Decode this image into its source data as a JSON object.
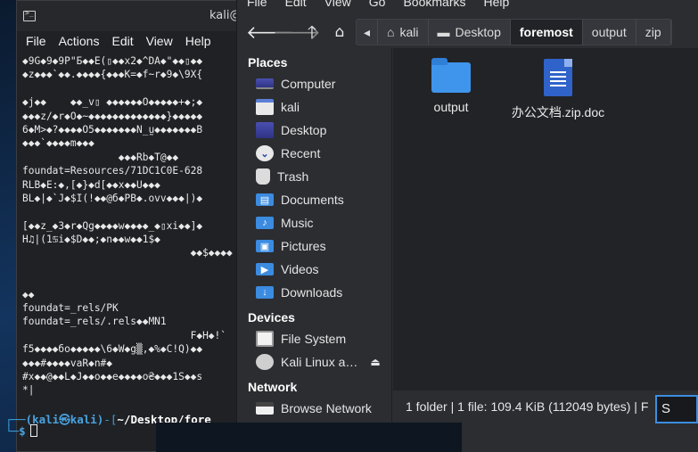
{
  "terminal": {
    "title": "kali@",
    "menu": [
      "File",
      "Actions",
      "Edit",
      "View",
      "Help"
    ],
    "lines": [
      "◆9G◆9◆9P\"Б◆◆E(▯◆◆x2◆^DA◆\"◆◆▯◆◆",
      "◆z◆◆◆`◆◆.◆◆◆◆{◆◆◆K=◆f~r◆9◆\\9X{",
      "",
      "◆j◆◆    ◆◆_v▯ ◆◆◆◆◆◆O◆◆◆◆◆+◆;◆",
      "◆◆◆z/◆r◆O◆~◆◆◆◆◆◆◆◆◆◆◆◆◆}◆◆◆◆◆",
      "6◆M>◆?◆◆◆◆O5◆◆◆◆◆◆◆N̲ṵ◆◆◆◆◆◆◆B",
      "◆◆◆`◆◆◆◆m◆◆◆",
      "                ◆◆◆Rb◆T@◆◆",
      "foundat=Resources/71DC1C0E-628",
      "RLB◆E:◆,[◆}◆d[◆◆x◆◆U◆◆◆",
      "BL◆|◆`J◆$I(!◆◆@б◆PB◆.ovv◆◆◆|)◆",
      "",
      "[◆◆z_◆3◆r◆Qg◆◆◆◆w◆◆◆◆_◆▯xi◆◆]◆",
      "H♫|(1♋i◆$D◆◆;◆n◆◆w◆◆1$◆",
      "                            ◆◆$◆◆◆◆",
      "",
      "",
      "◆◆",
      "foundat=_rels/PK",
      "foundat=_rels/.rels◆◆MN1",
      "                            F◆H◆!`",
      "f5◆◆◆◆бo◆◆◆◆◆\\6◆W◆g▒,◆%◆C!Q)◆◆",
      "◆◆◆#◆◆◆◆vaR◆n#◆",
      "#x◆◆@◆◆L◆J◆◆o◆◆e◆◆◆◆o₴◆◆◆1S◆◆s",
      "*|"
    ],
    "prompt_user": "(kali㉿kali)",
    "prompt_path": "~/Desktop/fore",
    "prompt_dollar": "$"
  },
  "file_manager": {
    "menu": [
      "File",
      "Edit",
      "View",
      "Go",
      "Bookmarks",
      "Help"
    ],
    "breadcrumbs": [
      "kali",
      "Desktop",
      "foremost",
      "output",
      "zip"
    ],
    "places_header": "Places",
    "places": [
      {
        "label": "Computer",
        "icon": "computer-icon"
      },
      {
        "label": "kali",
        "icon": "home-icon"
      },
      {
        "label": "Desktop",
        "icon": "desktop-icon"
      },
      {
        "label": "Recent",
        "icon": "recent-icon"
      },
      {
        "label": "Trash",
        "icon": "trash-icon"
      },
      {
        "label": "Documents",
        "icon": "documents-folder-icon"
      },
      {
        "label": "Music",
        "icon": "music-folder-icon"
      },
      {
        "label": "Pictures",
        "icon": "pictures-folder-icon"
      },
      {
        "label": "Videos",
        "icon": "videos-folder-icon"
      },
      {
        "label": "Downloads",
        "icon": "downloads-folder-icon"
      }
    ],
    "devices_header": "Devices",
    "devices": [
      {
        "label": "File System",
        "icon": "filesystem-icon"
      },
      {
        "label": "Kali Linux a…",
        "icon": "disc-icon"
      }
    ],
    "network_header": "Network",
    "network": [
      {
        "label": "Browse Network",
        "icon": "network-icon"
      }
    ],
    "files": [
      {
        "name": "output",
        "type": "folder"
      },
      {
        "name": "办公文档.zip.doc",
        "type": "document"
      }
    ],
    "status": "1 folder  |  1 file: 109.4 KiB (112049 bytes)  |  F",
    "search_value": "S",
    "colors": {
      "accent": "#3d8de0",
      "folder": "#3f95ec",
      "sidebar_bg": "#2b2d31"
    }
  }
}
